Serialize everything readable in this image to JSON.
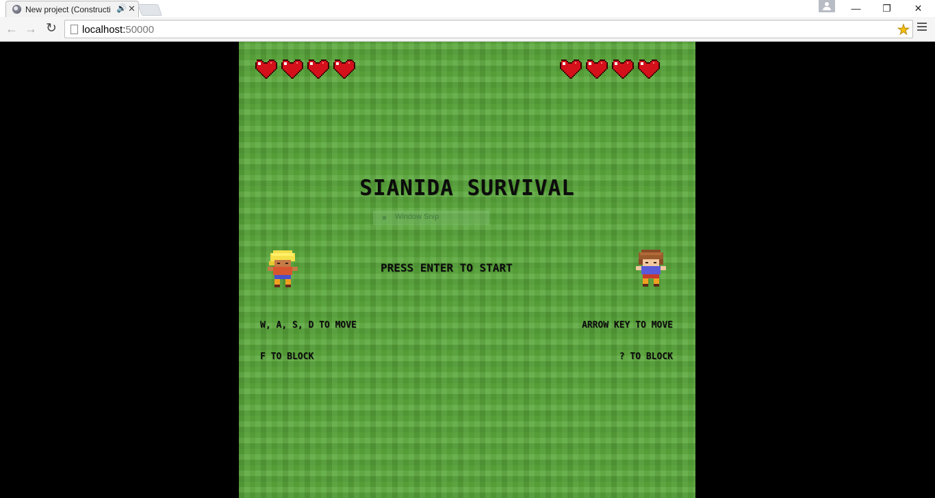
{
  "browser": {
    "tab_title": "New project (Constructi",
    "tab_audio_icon": "speaker-icon",
    "url_host": "localhost:",
    "url_port": "50000"
  },
  "game": {
    "title": "SIANIDA SURVIVAL",
    "prompt": "PRESS ENTER TO START",
    "player1": {
      "hearts": 4,
      "move_hint": "W, A, S, D TO MOVE",
      "block_hint": "F TO BLOCK"
    },
    "player2": {
      "hearts": 4,
      "move_hint": "ARROW KEY TO MOVE",
      "block_hint": "? TO BLOCK"
    },
    "overlay_label": "Window Snip",
    "colors": {
      "grass": "#5aa83b",
      "heart": "#d4101a",
      "text": "#0c0c0c"
    }
  }
}
